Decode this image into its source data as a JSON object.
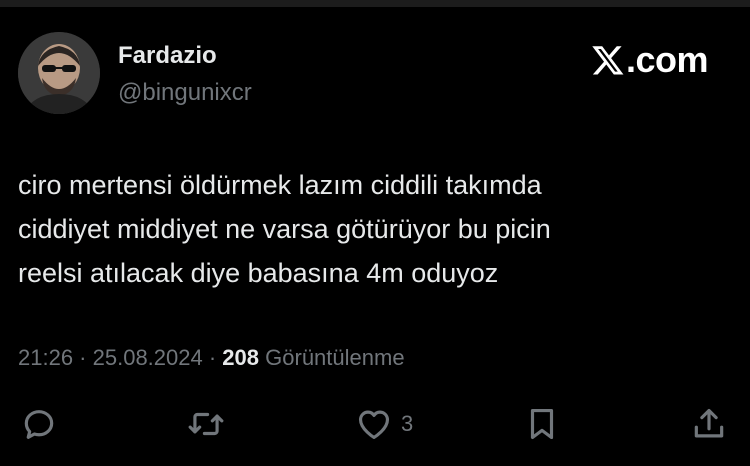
{
  "brand": {
    "site_label": ".com"
  },
  "author": {
    "display_name": "Fardazio",
    "handle": "@bingunixcr"
  },
  "tweet": {
    "lines": [
      "ciro mertensi öldürmek lazım ciddili takımda",
      "ciddiyet middiyet ne varsa götürüyor bu picin",
      "reelsi atılacak diye babasına 4m oduyoz"
    ],
    "time": "21:26",
    "date": "25.08.2024",
    "separator": " · ",
    "views_count": "208",
    "views_label": "Görüntülenme"
  },
  "actions": {
    "reply_icon": "reply-icon",
    "retweet_icon": "retweet-icon",
    "like_icon": "heart-icon",
    "like_count": "3",
    "bookmark_icon": "bookmark-icon",
    "share_icon": "share-icon"
  },
  "colors": {
    "background": "#000000",
    "text": "#e7e9ea",
    "muted": "#71767b"
  }
}
